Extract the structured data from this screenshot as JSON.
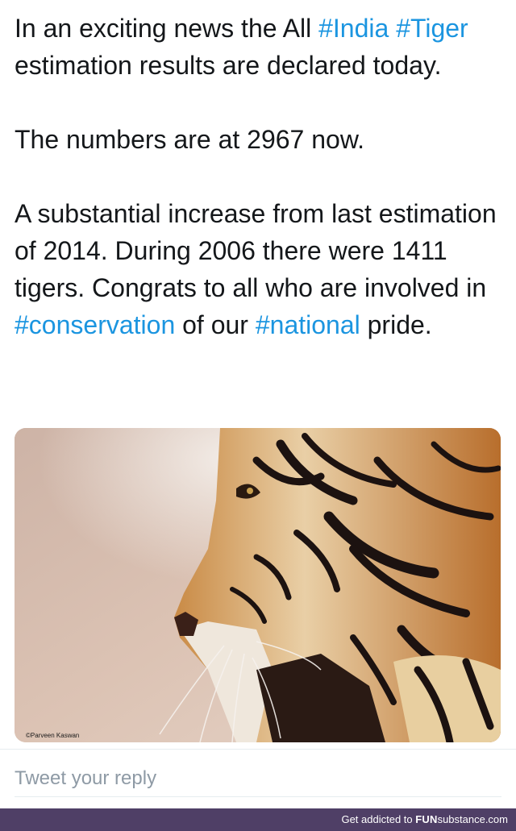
{
  "tweet": {
    "line1_pre": "In an exciting news the All ",
    "line1_tag": "#India",
    "line2_tag": "#Tiger",
    "line2_rest": " estimation results are declared today.",
    "para2": "The numbers are at 2967 now.",
    "para3_pre": "A substantial increase from last estimation of 2014. During 2006 there were 1411 tigers. Congrats to all who are involved in ",
    "para3_tag1": "#conservation",
    "para3_mid": " of our ",
    "para3_tag2": "#national",
    "para3_end": " pride."
  },
  "media": {
    "credit": "©Parveen Kaswan"
  },
  "reply": {
    "placeholder": "Tweet your reply"
  },
  "footer": {
    "text": "Get addicted to ",
    "brand_fun": "FUN",
    "brand_rest": "substance.com"
  },
  "colors": {
    "hashtag": "#1b95e0",
    "footer_bg": "#4f3f66",
    "placeholder": "#8e9aa5"
  }
}
